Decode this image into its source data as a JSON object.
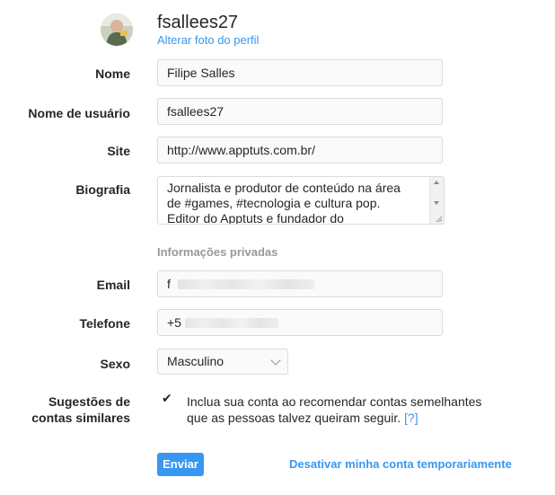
{
  "profile": {
    "username": "fsallees27",
    "change_photo_label": "Alterar foto do perfil",
    "avatar_icon": "profile-photo"
  },
  "form": {
    "name": {
      "label": "Nome",
      "value": "Filipe Salles"
    },
    "username": {
      "label": "Nome de usuário",
      "value": "fsallees27"
    },
    "website": {
      "label": "Site",
      "value": "http://www.apptuts.com.br/"
    },
    "bio": {
      "label": "Biografia",
      "lines": [
        "Jornalista e produtor de conteúdo na área",
        "de #games, #tecnologia e cultura pop.",
        "Editor do Apptuts e fundador do"
      ]
    },
    "private_section_title": "Informações privadas",
    "email": {
      "label": "Email",
      "value_visible": "f"
    },
    "phone": {
      "label": "Telefone",
      "value_visible": "+5"
    },
    "gender": {
      "label": "Sexo",
      "selected": "Masculino"
    },
    "suggestions": {
      "label_line1": "Sugestões de",
      "label_line2": "contas similares",
      "checked": true,
      "check_glyph": "✔",
      "text_line1": "Inclua sua conta ao recomendar contas semelhantes",
      "text_line2": "que as pessoas talvez queiram seguir.",
      "help_link": "[?]"
    },
    "submit_label": "Enviar",
    "deactivate_label": "Desativar minha conta temporariamente"
  },
  "colors": {
    "accent": "#3897f0",
    "text": "#262626",
    "muted": "#999999",
    "border": "#dbdbdb"
  }
}
